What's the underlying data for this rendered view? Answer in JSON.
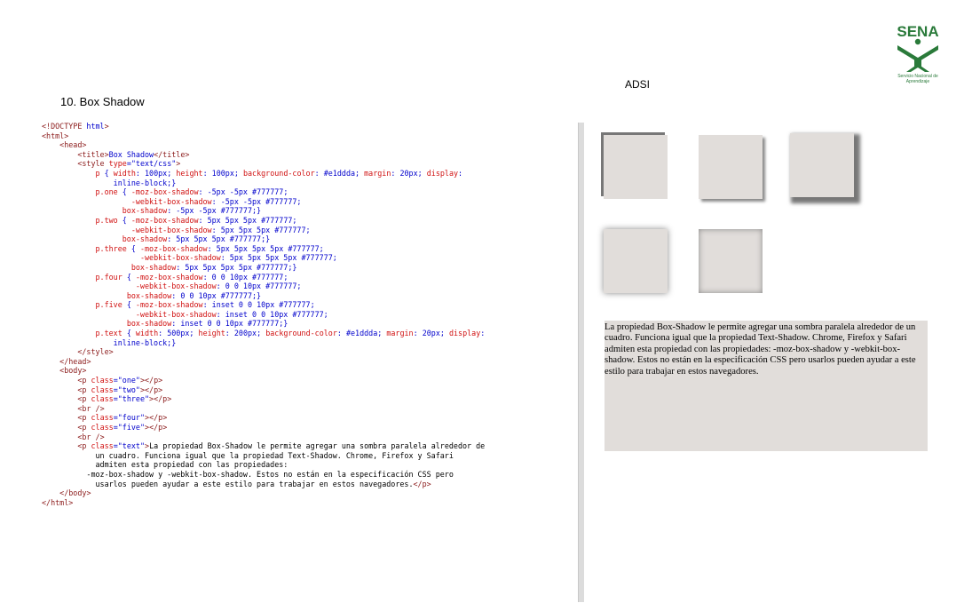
{
  "header": {
    "section_title": "10. Box Shadow",
    "adsi": "ADSI",
    "logo_text": "SENA",
    "logo_caption": "Servicio Nacional de Aprendizaje"
  },
  "code_lines": [
    "<!DOCTYPE html>",
    "<html>",
    "    <head>",
    "        <title>Box Shadow</title>",
    "        <style type=\"text/css\">",
    "            p { width: 100px; height: 100px; background-color: #e1ddda; margin: 20px; display:",
    "                inline-block;}",
    "            p.one { -moz-box-shadow: -5px -5px #777777;",
    "                    -webkit-box-shadow: -5px -5px #777777;",
    "                  box-shadow: -5px -5px #777777;}",
    "            p.two { -moz-box-shadow: 5px 5px 5px #777777;",
    "                    -webkit-box-shadow: 5px 5px 5px #777777;",
    "                  box-shadow: 5px 5px 5px #777777;}",
    "            p.three { -moz-box-shadow: 5px 5px 5px 5px #777777;",
    "                      -webkit-box-shadow: 5px 5px 5px 5px #777777;",
    "                    box-shadow: 5px 5px 5px 5px #777777;}",
    "            p.four { -moz-box-shadow: 0 0 10px #777777;",
    "                     -webkit-box-shadow: 0 0 10px #777777;",
    "                   box-shadow: 0 0 10px #777777;}",
    "            p.five { -moz-box-shadow: inset 0 0 10px #777777;",
    "                     -webkit-box-shadow: inset 0 0 10px #777777;",
    "                   box-shadow: inset 0 0 10px #777777;}",
    "            p.text { width: 500px; height: 200px; background-color: #e1ddda; margin: 20px; display:",
    "                inline-block;}",
    "        </style>",
    "    </head>",
    "    <body>",
    "        <p class=\"one\"></p>",
    "        <p class=\"two\"></p>",
    "        <p class=\"three\"></p>",
    "        <br />",
    "        <p class=\"four\"></p>",
    "        <p class=\"five\"></p>",
    "        <br />",
    "        <p class=\"text\">La propiedad Box-Shadow le permite agregar una sombra paralela alrededor de",
    "            un cuadro. Funciona igual que la propiedad Text-Shadow. Chrome, Firefox y Safari",
    "            admiten esta propiedad con las propiedades:",
    "          -moz-box-shadow y -webkit-box-shadow. Estos no están en la especificación CSS pero",
    "            usarlos pueden ayudar a este estilo para trabajar en estos navegadores.</p>",
    "    </body>",
    "</html>"
  ],
  "demo_text": "La propiedad Box-Shadow le permite agregar una sombra paralela alrededor de un cuadro. Funciona igual que la propiedad Text-Shadow. Chrome, Firefox y Safari admiten esta propiedad con las propiedades: -moz-box-shadow y -webkit-box-shadow. Estos no están en la especificación CSS pero usarlos pueden ayudar a este estilo para trabajar en estos navegadores.",
  "colors": {
    "box_background": "#e1ddda",
    "shadow": "#777777",
    "logo_green": "#2a7a3a"
  }
}
